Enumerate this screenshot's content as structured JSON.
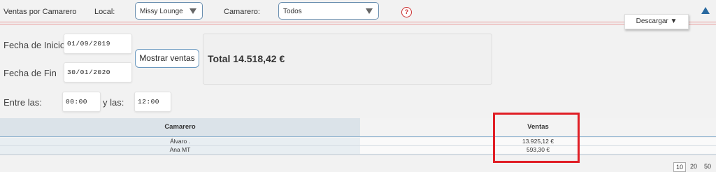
{
  "header": {
    "title": "Ventas por Camarero",
    "local_label": "Local:",
    "local_value": "Missy Lounge",
    "camarero_label": "Camarero:",
    "camarero_value": "Todos",
    "help_icon_text": "?",
    "download_label": "Descargar ▼"
  },
  "filters": {
    "start_label": "Fecha de Inicio",
    "start_value": "01/09/2019",
    "end_label": "Fecha de Fin",
    "end_value": "30/01/2020",
    "between_label": "Entre las:",
    "from_time": "00:00",
    "and_label": "y las:",
    "to_time": "12:00",
    "show_button": "Mostrar ventas"
  },
  "summary": {
    "total_text": "Total 14.518,42 €"
  },
  "table": {
    "columns": [
      "Camarero",
      "Ventas"
    ],
    "rows": [
      {
        "camarero": "Álvaro .",
        "ventas": "13.925,12 €"
      },
      {
        "camarero": "Ana MT",
        "ventas": "593,30 €"
      }
    ]
  },
  "pagination": {
    "options": [
      "10",
      "20",
      "50"
    ],
    "selected": "10"
  },
  "colors": {
    "accent": "#2a6aa0",
    "highlight": "#e01e25",
    "header_bg": "#dbe3e9"
  }
}
